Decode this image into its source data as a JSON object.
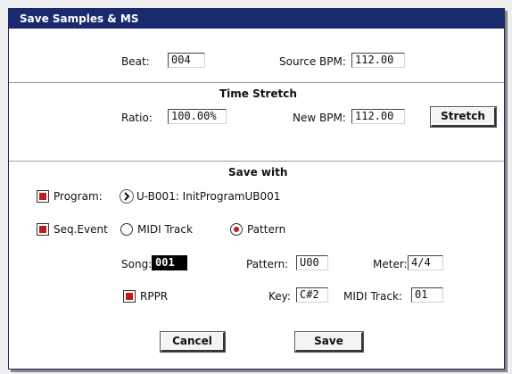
{
  "dialog": {
    "title": "Save Samples & MS"
  },
  "beat_row": {
    "beat_label": "Beat:",
    "beat_value": "004",
    "source_bpm_label": "Source BPM:",
    "source_bpm_value": "112.00"
  },
  "time_stretch": {
    "heading": "Time Stretch",
    "ratio_label": "Ratio:",
    "ratio_value": "100.00%",
    "new_bpm_label": "New BPM:",
    "new_bpm_value": "112.00",
    "stretch_button": "Stretch"
  },
  "save_with": {
    "heading": "Save with",
    "program_label": "Program:",
    "program_value": "U-B001: InitProgramUB001",
    "seq_event_label": "Seq.Event",
    "midi_track_option": "MIDI Track",
    "pattern_option": "Pattern",
    "song_label": "Song:",
    "song_value": "001",
    "pattern_label": "Pattern:",
    "pattern_value": "U00",
    "meter_label": "Meter:",
    "meter_value": "4/4",
    "rppr_label": "RPPR",
    "key_label": "Key:",
    "key_value": "C#2",
    "midi_track_label": "MIDI Track:",
    "midi_track_value": "01"
  },
  "footer": {
    "cancel_button": "Cancel",
    "save_button": "Save"
  },
  "state": {
    "program_checked": true,
    "seq_event_checked": true,
    "rppr_checked": true,
    "selected_source": "Pattern"
  },
  "colors": {
    "titlebar": "#1a2a6e",
    "check_accent": "#c01a1a"
  }
}
